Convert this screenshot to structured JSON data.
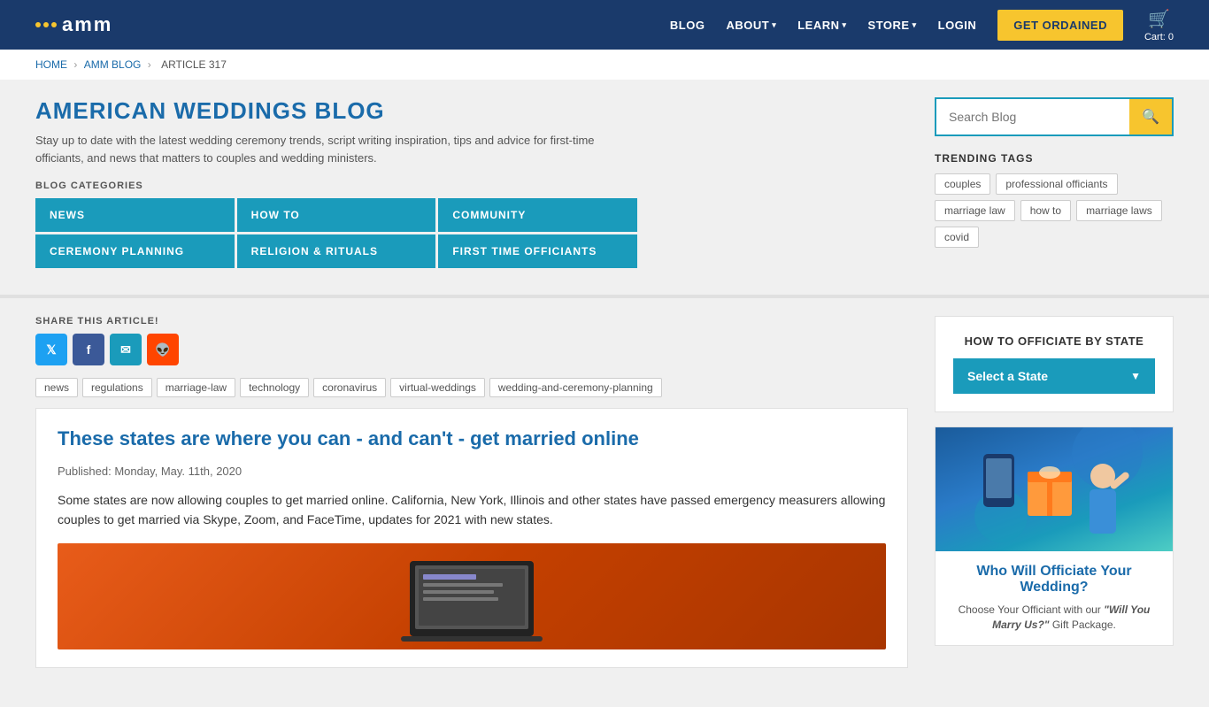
{
  "header": {
    "logo_text": "amm",
    "nav": {
      "blog": "BLOG",
      "about": "ABOUT",
      "learn": "LEARN",
      "store": "STORE",
      "login": "LOGIN",
      "get_ordained": "GET ORDAINED",
      "cart": "Cart:",
      "cart_count": "0"
    }
  },
  "breadcrumb": {
    "home": "HOME",
    "blog": "AMM BLOG",
    "current": "ARTICLE 317"
  },
  "blog": {
    "title": "AMERICAN WEDDINGS BLOG",
    "subtitle": "Stay up to date with the latest wedding ceremony trends, script writing inspiration, tips and advice for first-time officiants, and news that matters to couples and wedding ministers.",
    "categories_label": "BLOG CATEGORIES",
    "categories": [
      {
        "label": "NEWS"
      },
      {
        "label": "HOW TO"
      },
      {
        "label": "COMMUNITY"
      },
      {
        "label": "CEREMONY PLANNING"
      },
      {
        "label": "RELIGION & RITUALS"
      },
      {
        "label": "FIRST TIME OFFICIANTS"
      }
    ]
  },
  "sidebar": {
    "search_placeholder": "Search Blog",
    "trending_label": "TRENDING TAGS",
    "tags": [
      "couples",
      "professional officiants",
      "marriage law",
      "how to",
      "marriage laws",
      "covid"
    ]
  },
  "article": {
    "share_label": "SHARE THIS ARTICLE!",
    "tags": [
      "news",
      "regulations",
      "marriage-law",
      "technology",
      "coronavirus",
      "virtual-weddings",
      "wedding-and-ceremony-planning"
    ],
    "headline": "These states are where you can - and can't - get married online",
    "published": "Published: Monday, May. 11th, 2020",
    "body": "Some states are now allowing couples to get married online. California, New York, Illinois and other states have passed emergency measurers allowing couples to get married via Skype, Zoom, and FaceTime, updates for 2021 with new states."
  },
  "state_widget": {
    "title": "HOW TO OFFICIATE BY STATE",
    "select_label": "Select a State"
  },
  "officiate_card": {
    "title": "Who Will Officiate Your Wedding?",
    "description": "Choose Your Officiant with our ",
    "description_em": "\"Will You Marry Us?\"",
    "description_end": " Gift Package."
  }
}
